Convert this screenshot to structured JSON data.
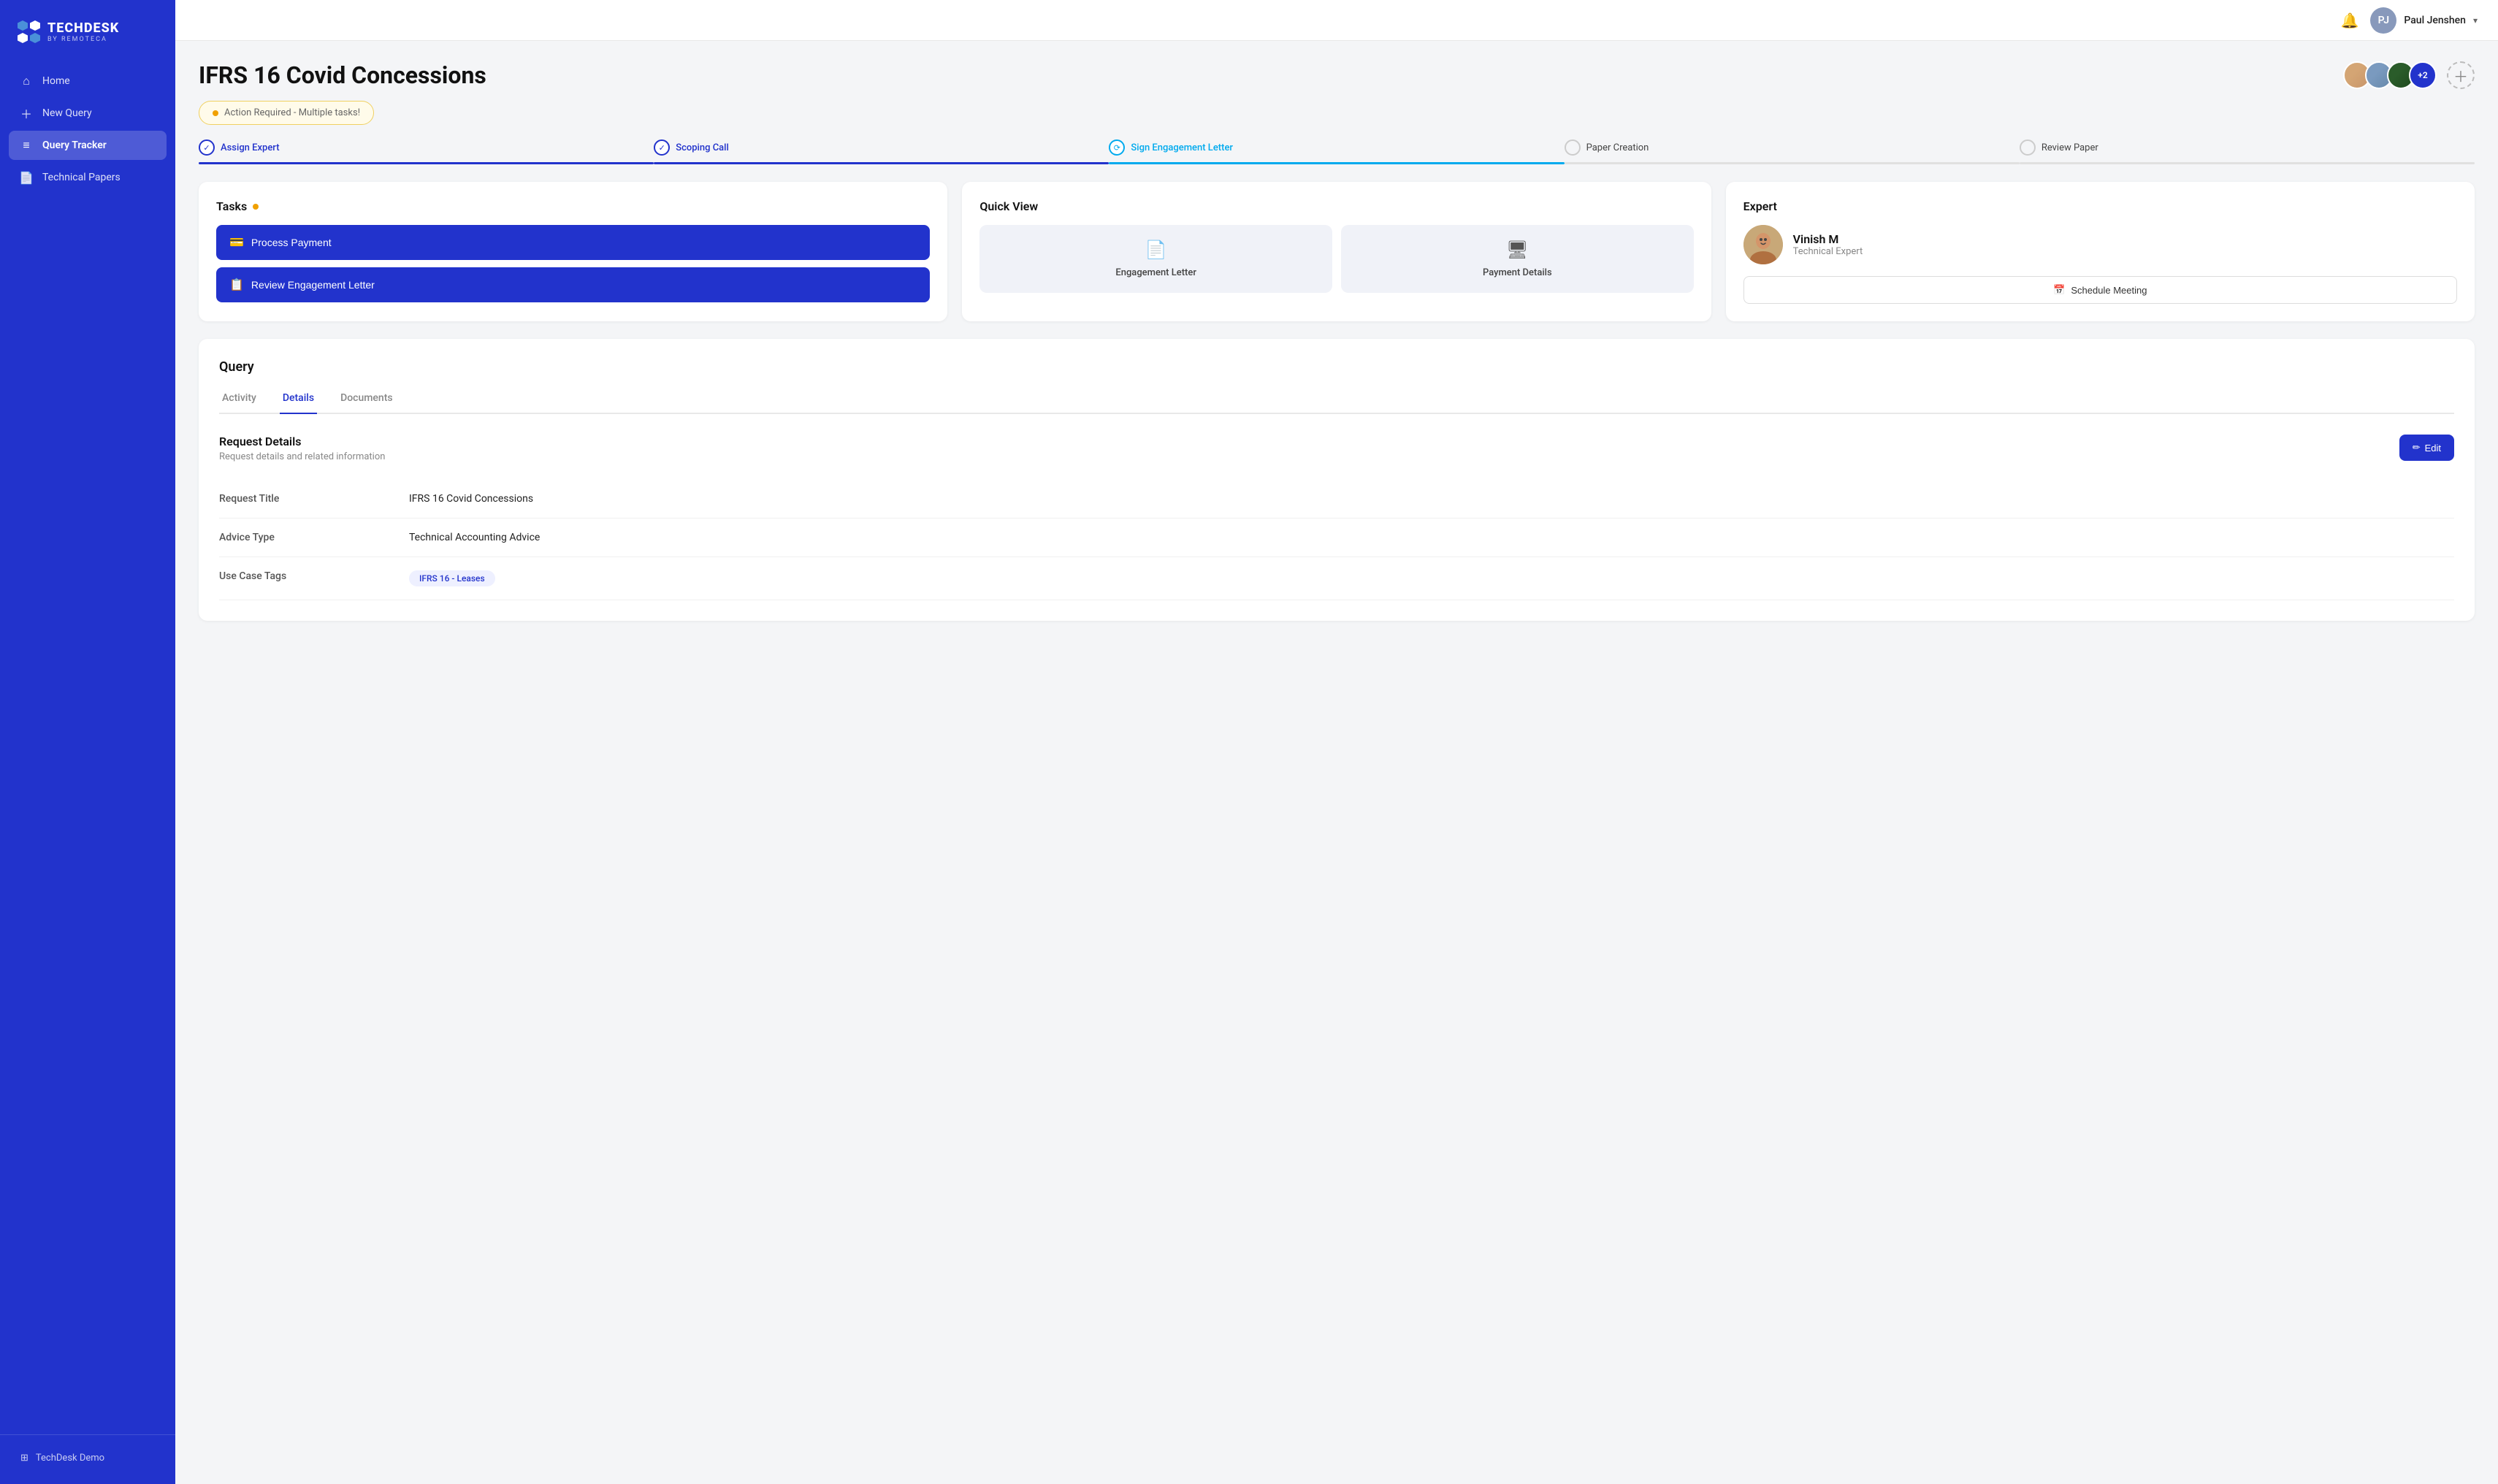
{
  "sidebar": {
    "logo_main": "TECHDESK",
    "logo_sub": "BY REMOTECA",
    "items": [
      {
        "id": "home",
        "label": "Home",
        "icon": "⌂",
        "active": false
      },
      {
        "id": "new-query",
        "label": "New Query",
        "icon": "+",
        "active": false
      },
      {
        "id": "query-tracker",
        "label": "Query Tracker",
        "icon": "≡",
        "active": true
      },
      {
        "id": "technical-papers",
        "label": "Technical Papers",
        "icon": "📄",
        "active": false
      }
    ],
    "bottom_item": "TechDesk Demo"
  },
  "topbar": {
    "user_name": "Paul Jenshen",
    "user_initials": "PJ"
  },
  "page": {
    "title": "IFRS 16 Covid Concessions",
    "alert": "Action Required - Multiple tasks!",
    "avatar_count": "+2"
  },
  "steps": [
    {
      "id": "assign-expert",
      "label": "Assign Expert",
      "state": "done"
    },
    {
      "id": "scoping-call",
      "label": "Scoping Call",
      "state": "done"
    },
    {
      "id": "sign-engagement",
      "label": "Sign Engagement Letter",
      "state": "active"
    },
    {
      "id": "paper-creation",
      "label": "Paper Creation",
      "state": "pending"
    },
    {
      "id": "review-paper",
      "label": "Review Paper",
      "state": "pending"
    }
  ],
  "tasks_card": {
    "title": "Tasks",
    "buttons": [
      {
        "id": "process-payment",
        "label": "Process Payment",
        "icon": "💳"
      },
      {
        "id": "review-engagement",
        "label": "Review Engagement Letter",
        "icon": "📋"
      }
    ]
  },
  "quick_view_card": {
    "title": "Quick View",
    "items": [
      {
        "id": "engagement-letter",
        "label": "Engagement Letter",
        "icon": "📄"
      },
      {
        "id": "payment-details",
        "label": "Payment Details",
        "icon": "💳"
      }
    ]
  },
  "expert_card": {
    "title": "Expert",
    "name": "Vinish M",
    "role": "Technical Expert",
    "schedule_label": "Schedule Meeting",
    "calendar_icon": "📅"
  },
  "query_section": {
    "title": "Query",
    "tabs": [
      {
        "id": "activity",
        "label": "Activity",
        "active": false
      },
      {
        "id": "details",
        "label": "Details",
        "active": true
      },
      {
        "id": "documents",
        "label": "Documents",
        "active": false
      }
    ],
    "details": {
      "section_title": "Request Details",
      "section_sub": "Request details and related information",
      "edit_label": "Edit",
      "fields": [
        {
          "label": "Request Title",
          "value": "IFRS 16 Covid Concessions",
          "type": "text"
        },
        {
          "label": "Advice Type",
          "value": "Technical Accounting Advice",
          "type": "text"
        },
        {
          "label": "Use Case Tags",
          "value": "IFRS 16 - Leases",
          "type": "tag"
        }
      ]
    }
  }
}
